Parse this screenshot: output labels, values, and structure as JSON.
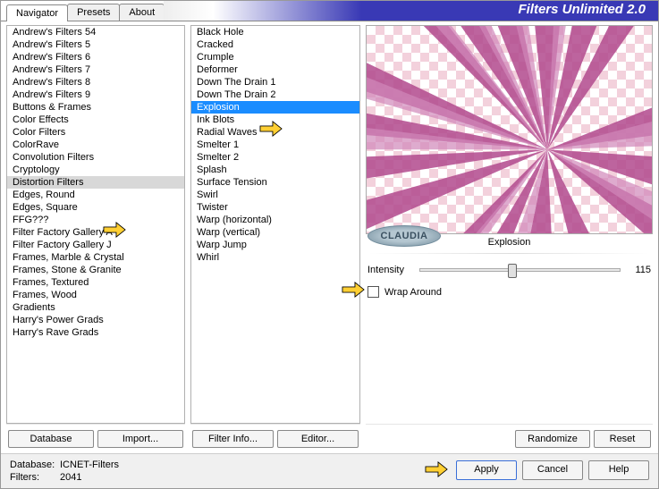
{
  "title": "Filters Unlimited 2.0",
  "tabs": [
    "Navigator",
    "Presets",
    "About"
  ],
  "active_tab": 0,
  "categories": [
    "Andrew's Filters 54",
    "Andrew's Filters 5",
    "Andrew's Filters 6",
    "Andrew's Filters 7",
    "Andrew's Filters 8",
    "Andrew's Filters 9",
    "Buttons & Frames",
    "Color Effects",
    "Color Filters",
    "ColorRave",
    "Convolution Filters",
    "Cryptology",
    "Distortion Filters",
    "Edges, Round",
    "Edges, Square",
    "FFG???",
    "Filter Factory Gallery A",
    "Filter Factory Gallery J",
    "Frames, Marble & Crystal",
    "Frames, Stone & Granite",
    "Frames, Textured",
    "Frames, Wood",
    "Gradients",
    "Harry's Power Grads",
    "Harry's Rave Grads"
  ],
  "selected_category_index": 12,
  "filters": [
    "Black Hole",
    "Cracked",
    "Crumple",
    "Deformer",
    "Down The Drain 1",
    "Down The Drain 2",
    "Explosion",
    "Ink Blots",
    "Radial Waves",
    "Smelter 1",
    "Smelter 2",
    "Splash",
    "Surface Tension",
    "Swirl",
    "Twister",
    "Warp (horizontal)",
    "Warp (vertical)",
    "Warp Jump",
    "Whirl"
  ],
  "selected_filter_index": 6,
  "selected_filter_label": "Explosion",
  "watermark": "CLAUDIA",
  "slider": {
    "label": "Intensity",
    "value": 115
  },
  "wrap_label": "Wrap Around",
  "cat_buttons": {
    "database": "Database",
    "import": "Import..."
  },
  "filter_buttons": {
    "info": "Filter Info...",
    "editor": "Editor..."
  },
  "preview_buttons": {
    "randomize": "Randomize",
    "reset": "Reset"
  },
  "footer": {
    "db_label": "Database:",
    "db_value": "ICNET-Filters",
    "filters_label": "Filters:",
    "filters_value": "2041",
    "apply": "Apply",
    "cancel": "Cancel",
    "help": "Help"
  }
}
